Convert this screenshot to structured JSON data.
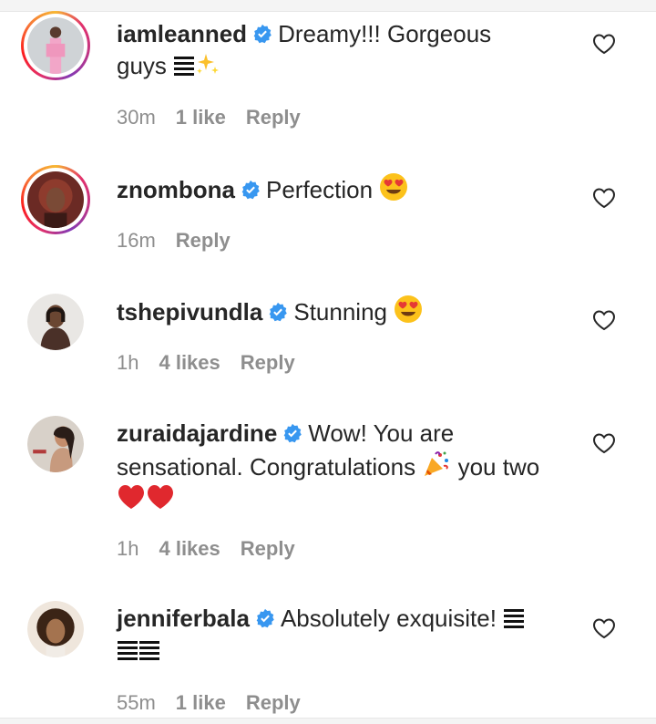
{
  "comments": [
    {
      "username": "iamleanned",
      "text_before": "Dreamy!!! Gorgeous guys",
      "emojis": [
        "bars-icon",
        "sparkles-icon"
      ],
      "time": "30m",
      "likes": "1 like",
      "reply": "Reply",
      "has_story_ring": true
    },
    {
      "username": "znombona",
      "text_before": "Perfection",
      "emojis": [
        "heart-eyes-icon"
      ],
      "time": "16m",
      "likes": "",
      "reply": "Reply",
      "has_story_ring": true
    },
    {
      "username": "tshepivundla",
      "text_before": "Stunning",
      "emojis": [
        "heart-eyes-icon"
      ],
      "time": "1h",
      "likes": "4 likes",
      "reply": "Reply",
      "has_story_ring": false
    },
    {
      "username": "zuraidajardine",
      "text_before": "Wow! You are sensational. Congratulations",
      "text_after": "you two",
      "emojis": [
        "party-popper-icon",
        "red-heart-icon",
        "red-heart-icon"
      ],
      "time": "1h",
      "likes": "4 likes",
      "reply": "Reply",
      "has_story_ring": false
    },
    {
      "username": "jenniferbala",
      "text_before": "Absolutely exquisite!",
      "emojis": [
        "bars-icon",
        "bars-icon",
        "bars-icon"
      ],
      "time": "55m",
      "likes": "1 like",
      "reply": "Reply",
      "has_story_ring": false
    }
  ],
  "colors": {
    "verified_blue": "#3897f0",
    "meta_gray": "#8e8e8e",
    "text": "#262626"
  }
}
